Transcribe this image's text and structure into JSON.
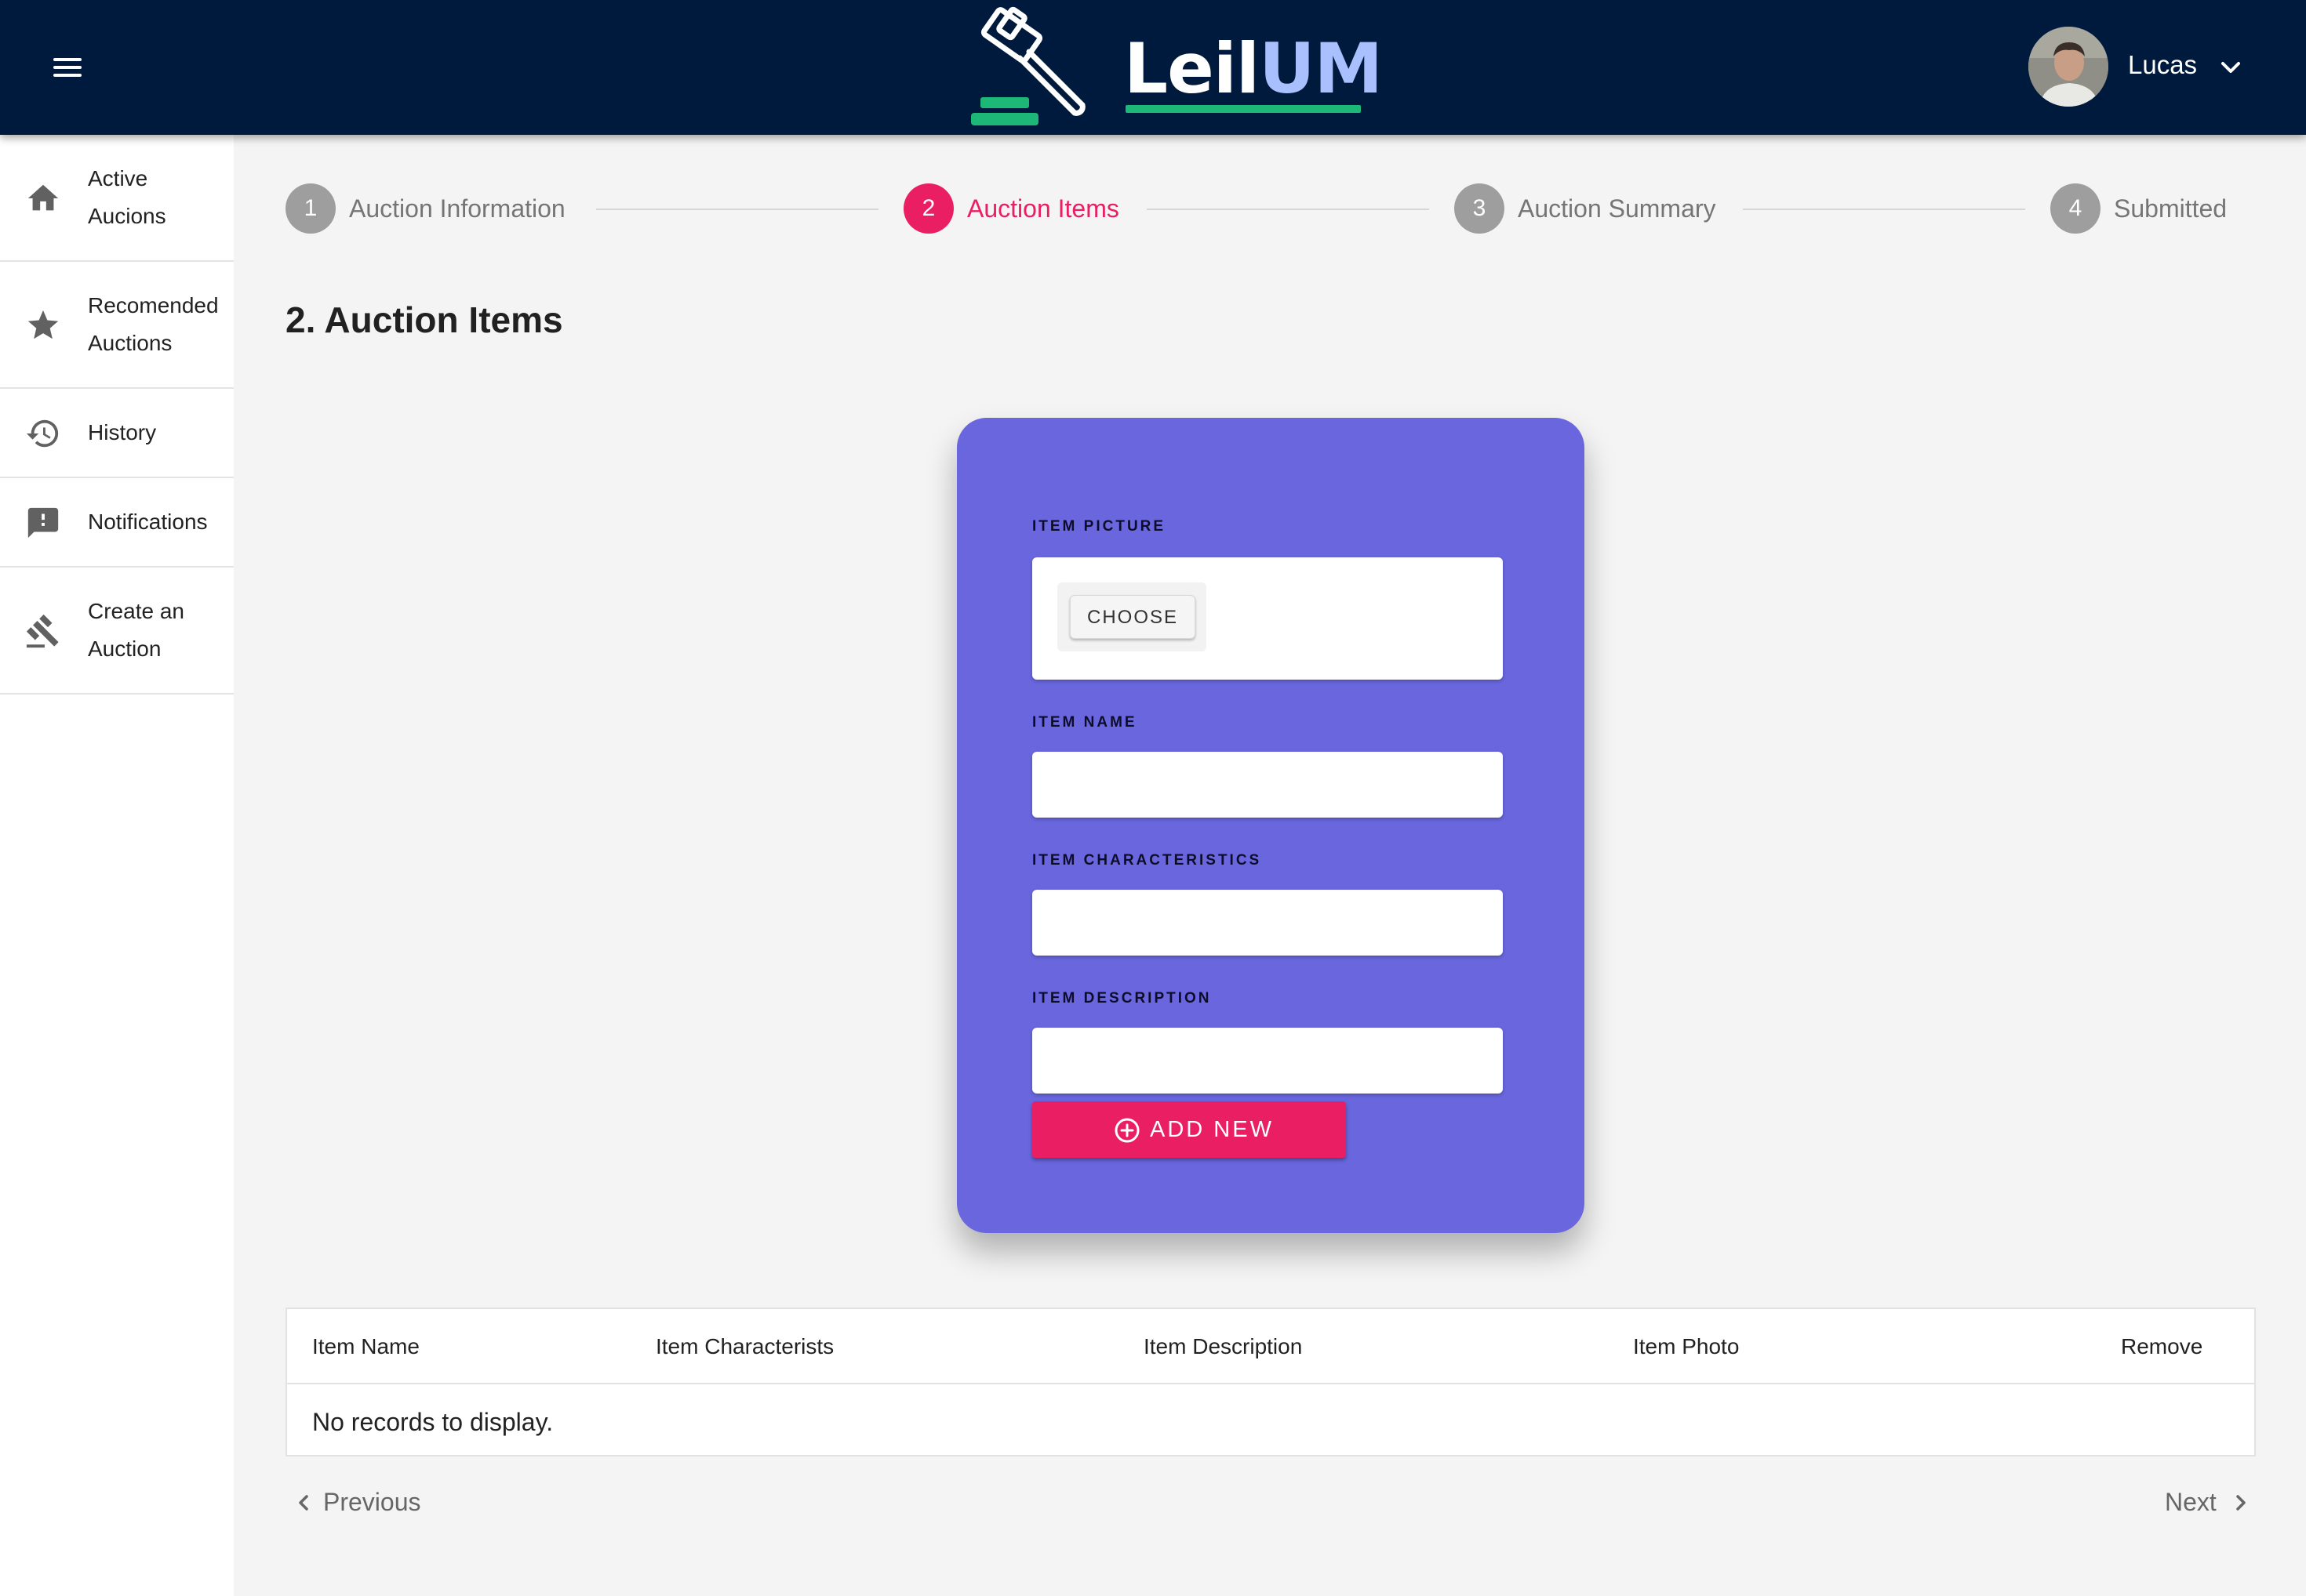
{
  "header": {
    "logo_left": "Leil",
    "logo_right": "UM",
    "user_name": "Lucas"
  },
  "sidebar": {
    "items": [
      {
        "label_line1": "Active",
        "label_line2": "Aucions",
        "icon": "home-icon"
      },
      {
        "label_line1": "Recomended",
        "label_line2": "Auctions",
        "icon": "star-icon"
      },
      {
        "label_line1": "History",
        "label_line2": "",
        "icon": "history-icon"
      },
      {
        "label_line1": "Notifications",
        "label_line2": "",
        "icon": "feedback-icon"
      },
      {
        "label_line1": "Create an",
        "label_line2": "Auction",
        "icon": "gavel-icon"
      }
    ]
  },
  "stepper": {
    "steps": [
      {
        "number": "1",
        "label": "Auction Information"
      },
      {
        "number": "2",
        "label": "Auction Items"
      },
      {
        "number": "3",
        "label": "Auction Summary"
      },
      {
        "number": "4",
        "label": "Submitted"
      }
    ],
    "active_step": 2
  },
  "page_title": "2. Auction Items",
  "form": {
    "picture_label": "ITEM PICTURE",
    "choose_label": "CHOOSE",
    "name_label": "ITEM NAME",
    "name_value": "",
    "characteristics_label": "ITEM CHARACTERISTICS",
    "characteristics_value": "",
    "description_label": "ITEM DESCRIPTION",
    "description_value": "",
    "add_label": "ADD NEW"
  },
  "table": {
    "columns": [
      "Item Name",
      "Item Characterists",
      "Item Description",
      "Item Photo",
      "Remove"
    ],
    "rows": [],
    "empty_message": "No records to display."
  },
  "pager": {
    "previous_label": "Previous",
    "next_label": "Next"
  },
  "colors": {
    "topbar": "#001a3d",
    "accent": "#e91e63",
    "card": "#6966de",
    "logo_green": "#1db877"
  }
}
